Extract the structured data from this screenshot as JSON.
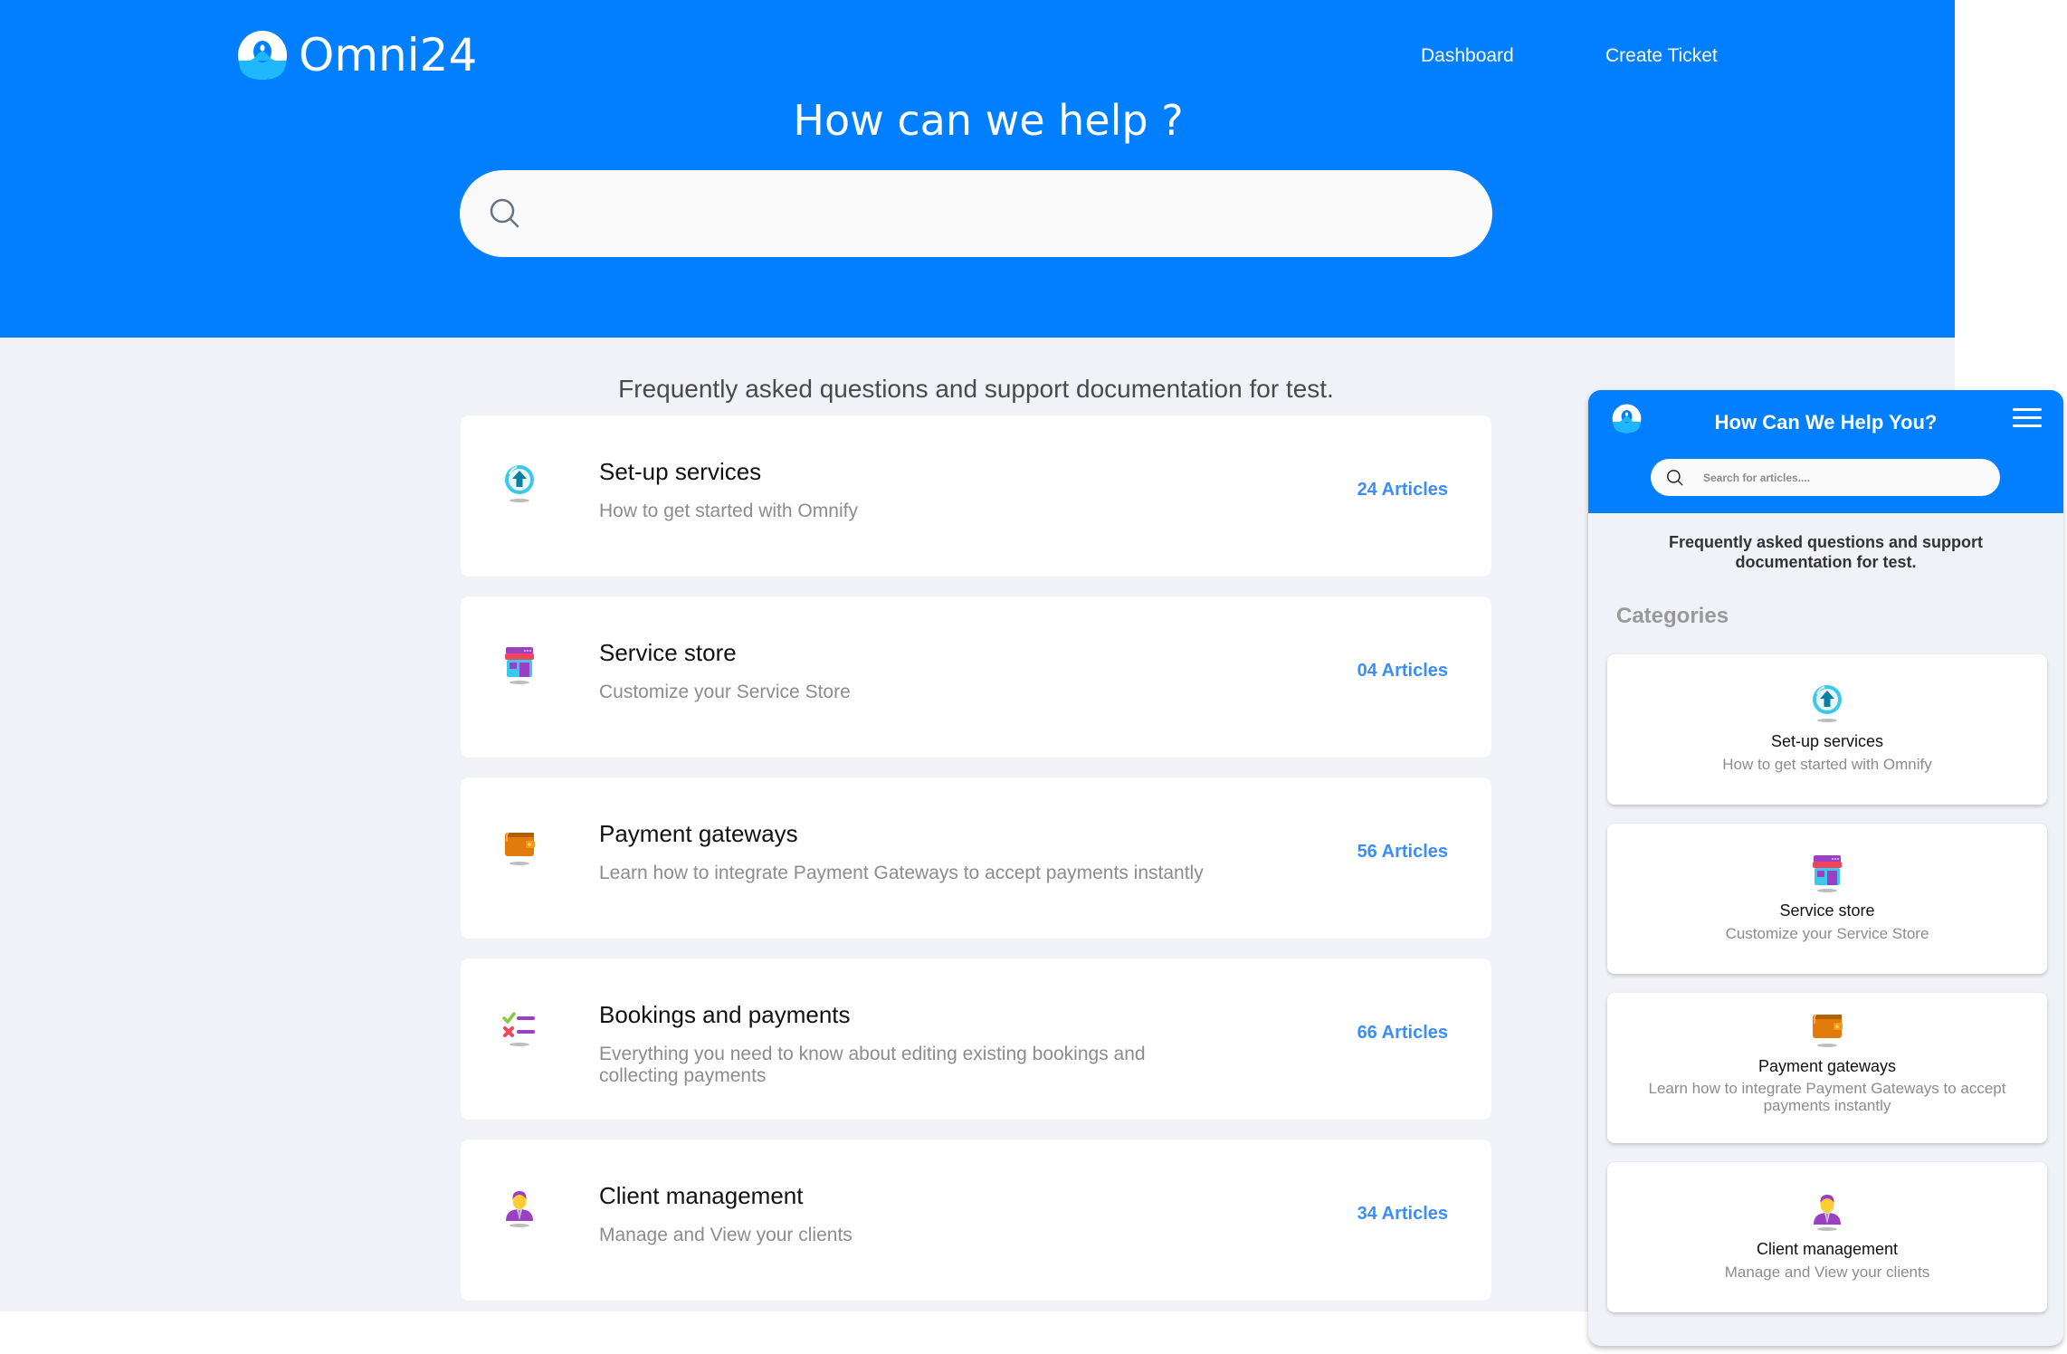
{
  "brand": {
    "name": "Omni24",
    "logo_icon": "omni24-logo-icon",
    "primary_color": "#017ffe",
    "accent_color": "#3a8ef5"
  },
  "nav": {
    "items": [
      {
        "label": "Dashboard"
      },
      {
        "label": "Create Ticket"
      }
    ]
  },
  "hero": {
    "title": "How can we help ?",
    "search": {
      "icon": "search-icon",
      "value": "",
      "placeholder": ""
    }
  },
  "faq_description": "Frequently asked questions and support documentation for test.",
  "categories": [
    {
      "icon": "upload-arrow-icon",
      "title": "Set-up services",
      "description": "How to get started with Omnify",
      "count": "24 Articles"
    },
    {
      "icon": "store-icon",
      "title": "Service store",
      "description": "Customize your Service Store",
      "count": "04 Articles"
    },
    {
      "icon": "wallet-icon",
      "title": "Payment gateways",
      "description": "Learn how to integrate Payment Gateways to accept payments instantly",
      "count": "56 Articles"
    },
    {
      "icon": "checklist-icon",
      "title": "Bookings and payments",
      "description": "Everything you need to know about editing existing bookings and collecting payments",
      "count": "66 Articles"
    },
    {
      "icon": "client-person-icon",
      "title": "Client management",
      "description": "Manage and View your clients",
      "count": "34 Articles"
    }
  ],
  "mobile": {
    "title": "How Can We Help You?",
    "menu_icon": "hamburger-menu-icon",
    "search": {
      "icon": "search-icon",
      "value": "",
      "placeholder": "Search for articles...."
    },
    "faq_description": "Frequently asked questions and support documentation for test.",
    "categories_heading": "Categories",
    "categories": [
      {
        "icon": "upload-arrow-icon",
        "title": "Set-up services",
        "description": "How to get started with Omnify"
      },
      {
        "icon": "store-icon",
        "title": "Service store",
        "description": "Customize your Service Store"
      },
      {
        "icon": "wallet-icon",
        "title": "Payment gateways",
        "description": "Learn how to integrate Payment Gateways to accept payments instantly"
      },
      {
        "icon": "client-person-icon",
        "title": "Client management",
        "description": "Manage and View your clients"
      }
    ]
  }
}
